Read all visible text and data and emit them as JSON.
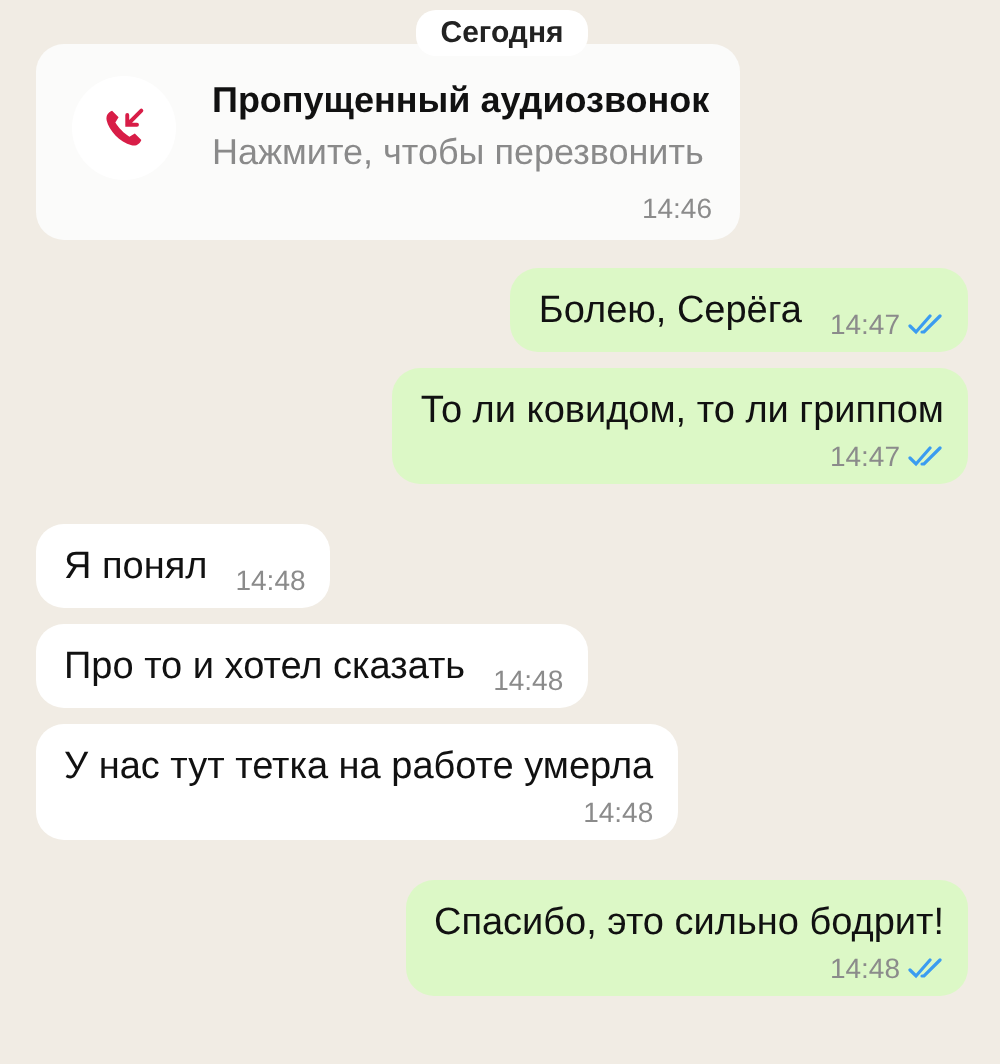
{
  "date_label": "Сегодня",
  "missed_call": {
    "title": "Пропущенный аудиозвонок",
    "subtitle": "Нажмите, чтобы перезвонить",
    "time": "14:46"
  },
  "messages": [
    {
      "kind": "inline",
      "text": "Болею, Серёга",
      "time": "14:47",
      "outgoing": true,
      "read": true
    },
    {
      "kind": "stacked",
      "text": "То ли ковидом, то ли гриппом",
      "time": "14:47",
      "outgoing": true,
      "read": true
    },
    {
      "kind": "inline",
      "text": "Я понял",
      "time": "14:48",
      "outgoing": false
    },
    {
      "kind": "inline",
      "text": "Про то и хотел сказать",
      "time": "14:48",
      "outgoing": false
    },
    {
      "kind": "stacked",
      "text": "У нас тут тетка на работе умерла",
      "time": "14:48",
      "outgoing": false
    },
    {
      "kind": "stacked",
      "text": "Спасибо, это сильно бодрит!",
      "time": "14:48",
      "outgoing": true,
      "read": true
    }
  ]
}
